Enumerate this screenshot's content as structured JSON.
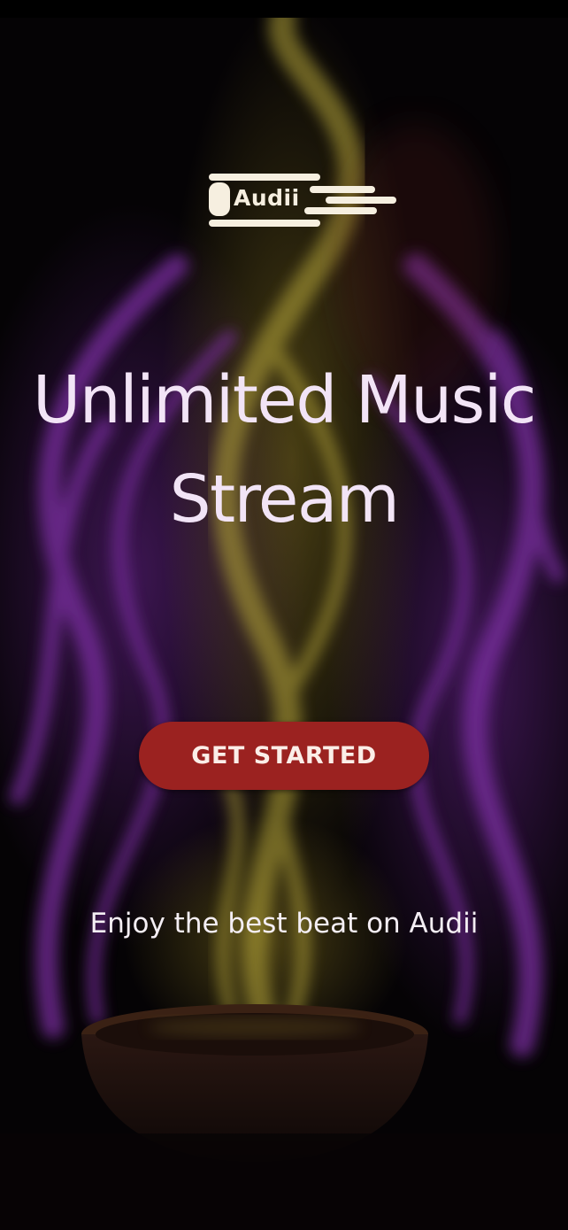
{
  "brand": {
    "logo_text": "Audii"
  },
  "hero": {
    "headline_line1": "Unlimited Music",
    "headline_line2": "Stream"
  },
  "actions": {
    "get_started_label": "GET STARTED"
  },
  "footer": {
    "tagline": "Enjoy the best beat on Audii"
  },
  "colors": {
    "button": "#9b2220",
    "headline": "#f2e4f6",
    "smoke_purple": "#7a2fa0",
    "smoke_yellow": "#b8a83a",
    "background": "#050305"
  },
  "background_image": "purple-and-yellow-smoke-rising-from-bowl"
}
